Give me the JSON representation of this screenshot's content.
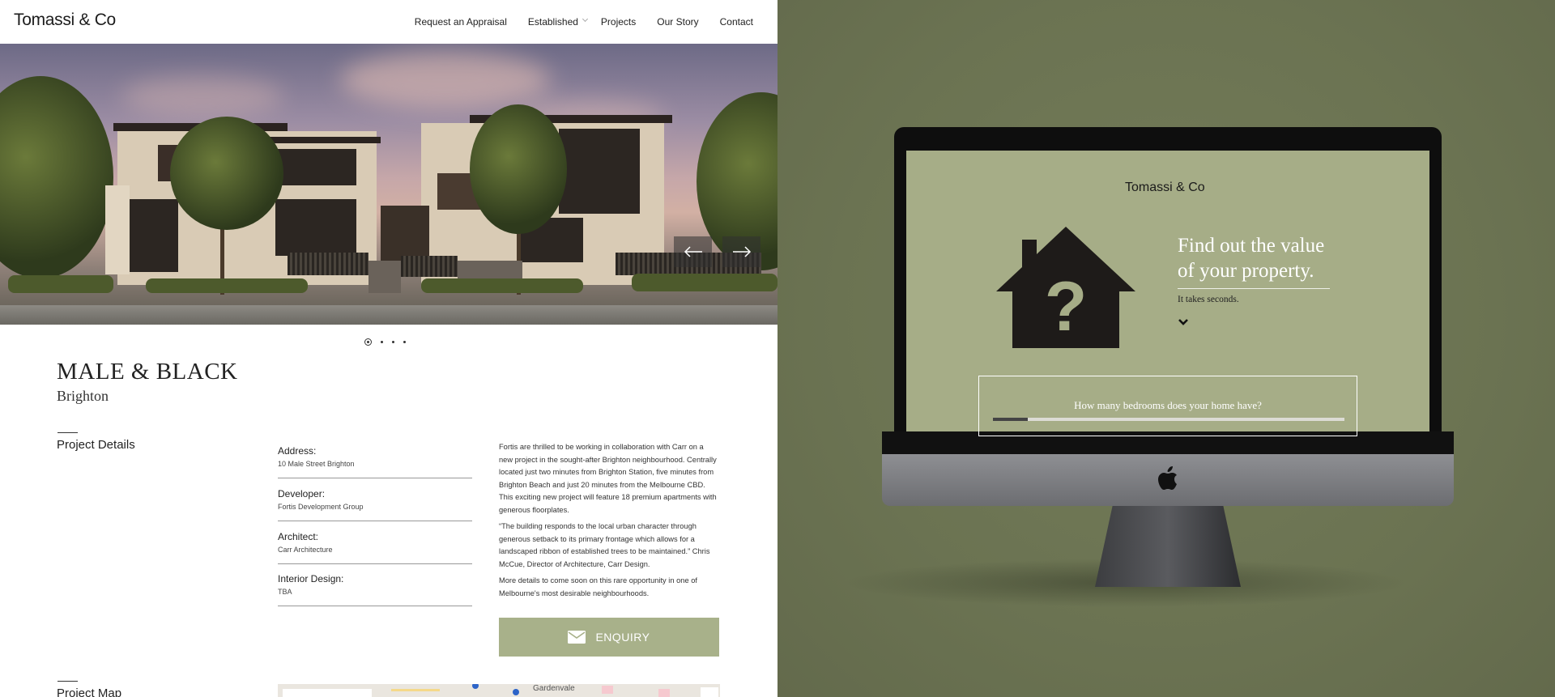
{
  "site": {
    "logo": "Tomassi & Co",
    "nav": [
      "Request an Appraisal",
      "Established",
      "Projects",
      "Our Story",
      "Contact"
    ]
  },
  "hero": {
    "slide_count": 4,
    "active_slide": 1,
    "prev_icon": "arrow-left-icon",
    "next_icon": "arrow-right-icon"
  },
  "project": {
    "title": "MALE & BLACK",
    "suburb": "Brighton",
    "details_heading": "Project Details",
    "details": [
      {
        "label": "Address:",
        "value": "10 Male Street Brighton"
      },
      {
        "label": "Developer:",
        "value": "Fortis Development Group"
      },
      {
        "label": "Architect:",
        "value": "Carr Architecture"
      },
      {
        "label": "Interior Design:",
        "value": "TBA"
      }
    ],
    "description": [
      "Fortis are thrilled to be working in collaboration with Carr on a new project in the sought-after Brighton neighbourhood. Centrally located just two minutes from Brighton Station, five minutes from Brighton Beach and just 20 minutes from the Melbourne CBD. This exciting new project will feature 18 premium apartments with generous floorplates.",
      "“The building responds to the local urban character through generous setback to its primary frontage which allows for a landscaped ribbon of established trees to be maintained.” Chris McCue, Director of Architecture, Carr Design.",
      "More details to come soon on this rare opportunity in one of Melbourne's most desirable neighbourhoods."
    ],
    "enquiry_label": "ENQUIRY",
    "map_heading": "Project Map",
    "map_place": "Gardenvale"
  },
  "screen": {
    "logo": "Tomassi & Co",
    "headline_line1": "Find out the value",
    "headline_line2": "of your property.",
    "subtext": "It takes seconds.",
    "question": "How many bedrooms does your home have?",
    "progress": 0.1,
    "house_icon": "house-question-icon",
    "chevron_icon": "chevron-down-icon"
  },
  "colors": {
    "accent": "#a8b18a",
    "background": "#6e7654",
    "dark": "#1c1c1c"
  }
}
